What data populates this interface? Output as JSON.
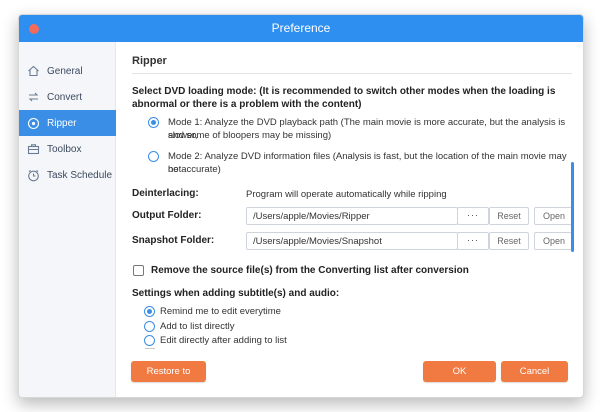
{
  "window": {
    "title": "Preference"
  },
  "sidebar": {
    "items": [
      {
        "label": "General",
        "icon": "home-icon",
        "active": false
      },
      {
        "label": "Convert",
        "icon": "convert-icon",
        "active": false
      },
      {
        "label": "Ripper",
        "icon": "ripper-icon",
        "active": true
      },
      {
        "label": "Toolbox",
        "icon": "toolbox-icon",
        "active": false
      },
      {
        "label": "Task Schedule",
        "icon": "clock-icon",
        "active": false
      }
    ]
  },
  "ripper": {
    "section_title": "Ripper",
    "dvd_mode_label": "Select DVD loading mode: (It is recommended to switch other modes when the loading is abnormal or there is a problem with the content)",
    "mode1_line1": "Mode 1: Analyze the DVD playback path (The main movie is more accurate, but the analysis is slower,",
    "mode1_line2": "and some of bloopers may be missing)",
    "mode2_line1": "Mode 2: Analyze DVD information files (Analysis is fast, but the location of the main movie may not",
    "mode2_line2": "be accurate)",
    "selected_mode": 1,
    "deinterlacing_label": "Deinterlacing:",
    "deinterlacing_text": "Program will operate automatically while ripping",
    "output_label": "Output Folder:",
    "output_path": "/Users/apple/Movies/Ripper",
    "snapshot_label": "Snapshot Folder:",
    "snapshot_path": "/Users/apple/Movies/Snapshot",
    "browse_label": "···",
    "reset_label": "Reset",
    "open_label": "Open",
    "remove_source_label": "Remove the source file(s) from the Converting list after conversion",
    "remove_source_checked": false,
    "subtitle_settings_label": "Settings when adding subtitle(s) and audio:",
    "subtitle_options": [
      {
        "label": "Remind me to edit everytime",
        "selected": true
      },
      {
        "label": "Add to list directly",
        "selected": false
      },
      {
        "label": "Edit directly after adding to list",
        "selected": false
      }
    ]
  },
  "footer": {
    "restore_label": "Restore to Default",
    "ok_label": "OK",
    "cancel_label": "Cancel"
  },
  "colors": {
    "titlebar": "#2f8ff0",
    "accent": "#3a8ee6",
    "button_orange": "#f07a42",
    "close_dot": "#f26b5b"
  }
}
